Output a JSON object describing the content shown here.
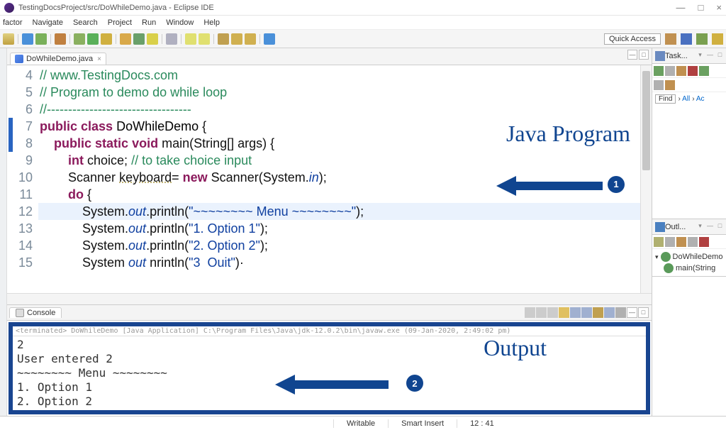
{
  "window": {
    "title": "TestingDocsProject/src/DoWhileDemo.java - Eclipse IDE",
    "minimize": "—",
    "maximize": "□",
    "close": "×"
  },
  "menu": [
    "factor",
    "Navigate",
    "Search",
    "Project",
    "Run",
    "Window",
    "Help"
  ],
  "quick_access": "Quick Access",
  "editor_tab": {
    "label": "DoWhileDemo.java",
    "close": "×"
  },
  "code_lines": [
    {
      "n": "4",
      "html": "<span class='cmt'>// www.TestingDocs.com</span>"
    },
    {
      "n": "5",
      "html": "<span class='cmt'>// Program to demo do while loop</span>"
    },
    {
      "n": "6",
      "html": "<span class='cmt'>//----------------------------------</span>"
    },
    {
      "n": "7",
      "html": "<span class='kw'>public</span> <span class='kw'>class</span> <span class='cls'>DoWhileDemo</span> {",
      "mk": true
    },
    {
      "n": "8",
      "html": "    <span class='kw'>public</span> <span class='kw'>static</span> <span class='kw'>void</span> main(String[] args) {",
      "mk": true
    },
    {
      "n": "9",
      "html": "        <span class='kw'>int</span> choice; <span class='cmt'>// to take choice input</span>"
    },
    {
      "n": "10",
      "html": "        Scanner <span class='under'>keyboard</span>= <span class='kw'>new</span> Scanner(System.<span class='fld'>in</span>);"
    },
    {
      "n": "11",
      "html": "        <span class='kw'>do</span> {"
    },
    {
      "n": "12",
      "html": "            System.<span class='fld'>out</span>.println(<span class='str'>\"~~~~~~~~ Menu ~~~~~~~~\"</span>);",
      "hl": true
    },
    {
      "n": "13",
      "html": "            System.<span class='fld'>out</span>.println(<span class='str'>\"1. Option 1\"</span>);"
    },
    {
      "n": "14",
      "html": "            System.<span class='fld'>out</span>.println(<span class='str'>\"2. Option 2\"</span>);"
    },
    {
      "n": "15",
      "html": "            System <span class='fld'>out</span> nrintln(<span class='str'>\"3  Ouit\"</span>)·"
    }
  ],
  "annotations": {
    "label1": "Java Program",
    "label2": "Output",
    "num1": "1",
    "num2": "2"
  },
  "console_tab": "Console",
  "console_term": "<terminated> DoWhileDemo [Java Application] C:\\Program Files\\Java\\jdk-12.0.2\\bin\\javaw.exe (09-Jan-2020, 2:49:02 pm)",
  "console_out": "2\nUser entered 2\n~~~~~~~~ Menu ~~~~~~~~\n1. Option 1\n2. Option 2",
  "right": {
    "task_label": "Task...",
    "find": "Find",
    "all": "All",
    "activate": "Ac",
    "outline_label": "Outl...",
    "outline_items": [
      {
        "icon": "class",
        "label": "DoWhileDemo"
      },
      {
        "icon": "method",
        "label": "main(String"
      }
    ]
  },
  "status": {
    "writable": "Writable",
    "insert": "Smart Insert",
    "pos": "12 : 41"
  }
}
